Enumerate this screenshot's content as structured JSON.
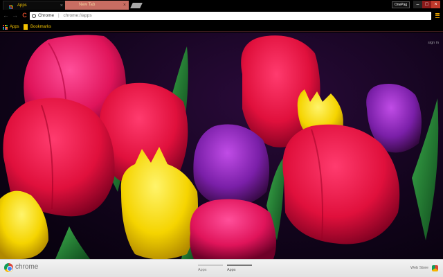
{
  "tabs": [
    {
      "label": "Apps",
      "close": "×"
    },
    {
      "label": "New Tab",
      "close": "×"
    }
  ],
  "window": {
    "profile_label": "OnePag",
    "minimize": "–",
    "maximize": "□",
    "close": "×"
  },
  "toolbar": {
    "back": "←",
    "forward": "→",
    "reload": "C",
    "site_label": "Chrome",
    "separator": "|",
    "url": "chrome://apps"
  },
  "bookmarks": [
    {
      "label": "Apps",
      "icon": "apps-grid-icon"
    },
    {
      "label": "Bookmarks",
      "icon": "folder-icon"
    }
  ],
  "content": {
    "signin": "sign in"
  },
  "bottom": {
    "brand": "chrome",
    "page_tabs": [
      {
        "label": "Apps"
      },
      {
        "label": "Apps"
      }
    ],
    "webstore": "Web Store"
  },
  "colors": {
    "accent": "#f2c200",
    "tab_inactive": "#c86d62",
    "close_red": "#c0392b"
  }
}
